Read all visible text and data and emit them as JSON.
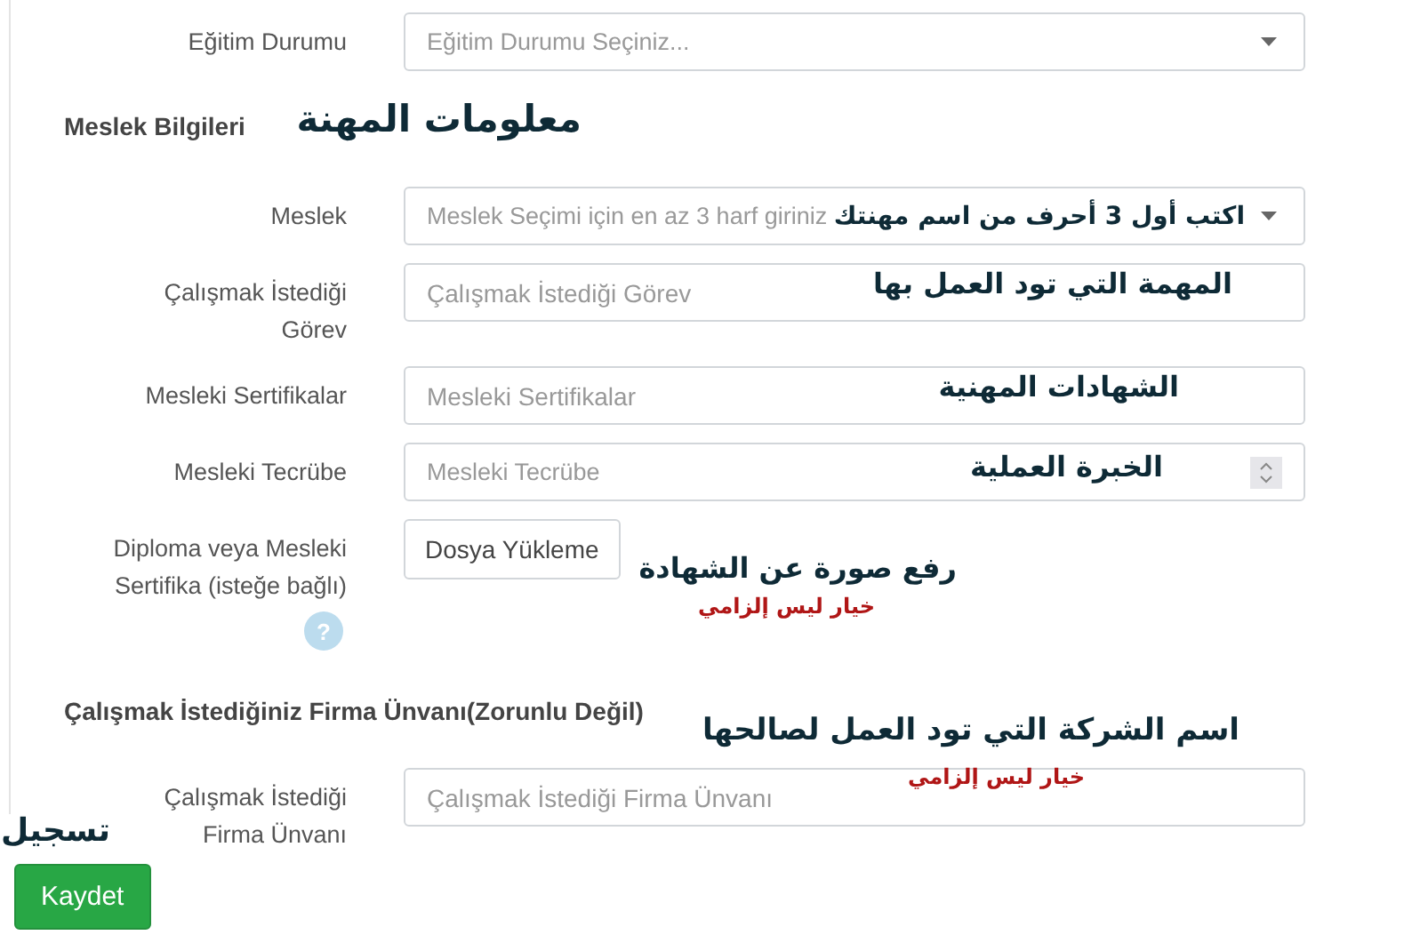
{
  "form": [
    {
      "kind": "select",
      "label": "Eğitim Durumu",
      "placeholder": "Eğitim Durumu Seçiniz..."
    },
    {
      "kind": "heading",
      "text": "Meslek Bilgileri"
    },
    {
      "kind": "select",
      "label": "Meslek",
      "placeholder": "Meslek Seçimi için en az 3 harf giriniz"
    },
    {
      "kind": "text",
      "label": "Çalışmak İstediği Görev",
      "placeholder": "Çalışmak İstediği Görev"
    },
    {
      "kind": "text",
      "label": "Mesleki Sertifikalar",
      "placeholder": "Mesleki Sertifikalar"
    },
    {
      "kind": "number",
      "label": "Mesleki Tecrübe",
      "placeholder": "Mesleki Tecrübe"
    },
    {
      "kind": "file",
      "label": "Diploma veya Mesleki Sertifika (isteğe bağlı)",
      "button": "Dosya Yükleme",
      "help": "?"
    },
    {
      "kind": "heading",
      "text": "Çalışmak İstediğiniz Firma Ünvanı(Zorunlu Değil)"
    },
    {
      "kind": "text",
      "label": "Çalışmak İstediği Firma Ünvanı",
      "placeholder": "Çalışmak İstediği Firma Ünvanı"
    }
  ],
  "submit": "Kaydet",
  "annotations": [
    {
      "kind": "title",
      "text": "معلومات المهنة"
    },
    {
      "kind": "title",
      "text": "اكتب أول 3 أحرف من اسم مهنتك"
    },
    {
      "kind": "title",
      "text": "المهمة التي تود العمل بها"
    },
    {
      "kind": "title",
      "text": "الشهادات المهنية"
    },
    {
      "kind": "title",
      "text": "الخبرة العملية"
    },
    {
      "kind": "title",
      "text": "رفع صورة عن الشهادة"
    },
    {
      "kind": "note",
      "text": "خيار ليس إلزامي"
    },
    {
      "kind": "title",
      "text": "اسم الشركة التي تود العمل لصالحها"
    },
    {
      "kind": "note",
      "text": "خيار ليس إلزامي"
    },
    {
      "kind": "title",
      "text": "تسجيل"
    }
  ]
}
